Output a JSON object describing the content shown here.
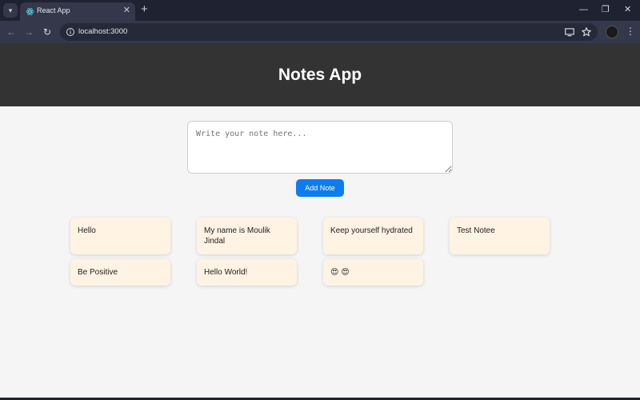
{
  "browser": {
    "tab_title": "React App",
    "url": "localhost:3000",
    "colors": {
      "tabbar": "#1f2230",
      "toolbar": "#34384a",
      "omnibox": "#262937"
    }
  },
  "app": {
    "title": "Notes App",
    "input_placeholder": "Write your note here...",
    "input_value": "",
    "add_button_label": "Add Note",
    "colors": {
      "header": "#333333",
      "button": "#0d7cf2",
      "note_card": "#fff3e3",
      "background": "#f5f5f5"
    }
  },
  "notes": [
    {
      "text": "Hello"
    },
    {
      "text": "My name is Moulik Jindal"
    },
    {
      "text": "Keep yourself hydrated"
    },
    {
      "text": "Test Notee"
    },
    {
      "text": "Be Positive"
    },
    {
      "text": "Hello World!"
    },
    {
      "text": "😍 😍"
    }
  ]
}
